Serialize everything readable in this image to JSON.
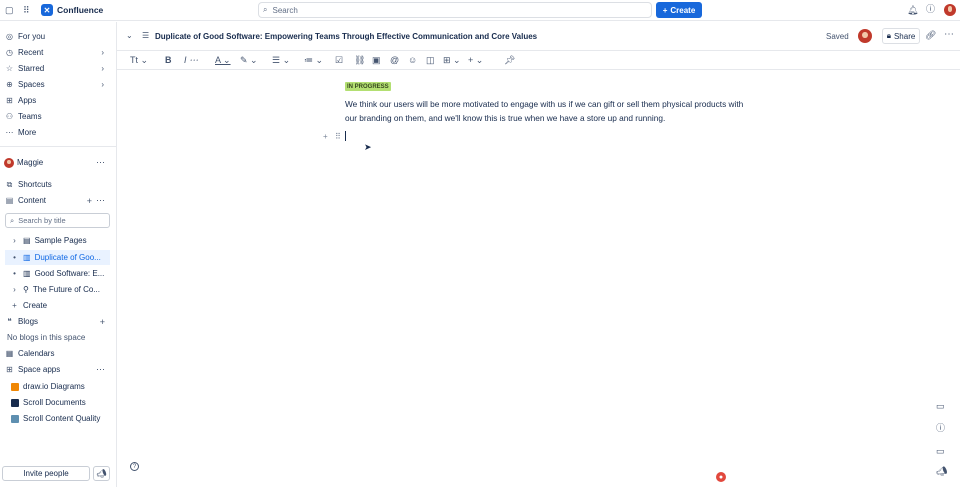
{
  "app": {
    "name": "Confluence"
  },
  "topbar": {
    "search_placeholder": "Search",
    "create_label": "Create",
    "create_plus": "+"
  },
  "sidebar": {
    "nav": [
      {
        "icon": "user-circle-icon",
        "glyph": "◎",
        "label": "For you"
      },
      {
        "icon": "clock-icon",
        "glyph": "◷",
        "label": "Recent",
        "chevron": "›"
      },
      {
        "icon": "star-icon",
        "glyph": "☆",
        "label": "Starred",
        "chevron": "›"
      },
      {
        "icon": "globe-icon",
        "glyph": "⊕",
        "label": "Spaces",
        "chevron": "›"
      },
      {
        "icon": "apps-icon",
        "glyph": "⊞",
        "label": "Apps"
      },
      {
        "icon": "teams-icon",
        "glyph": "⚇",
        "label": "Teams"
      },
      {
        "icon": "more-icon",
        "glyph": "⋯",
        "label": "More"
      }
    ],
    "space_name": "Maggie",
    "shortcuts": "Shortcuts",
    "content": "Content",
    "filter_placeholder": "Search by title",
    "tree": [
      {
        "label": "Sample Pages",
        "selected": false
      },
      {
        "label": "Duplicate of Goo...",
        "selected": true
      },
      {
        "label": "Good Software: E...",
        "selected": false
      },
      {
        "label": "The Future of Co...",
        "selected": false
      }
    ],
    "create_label": "Create",
    "blogs": "Blogs",
    "no_blogs": "No blogs in this space",
    "calendars": "Calendars",
    "space_apps": "Space apps",
    "apps": [
      {
        "label": "draw.io Diagrams",
        "color": "#f08705"
      },
      {
        "label": "Scroll Documents",
        "color": "#172b4d"
      },
      {
        "label": "Scroll Content Quality",
        "color": "#5e8fb0"
      }
    ],
    "invite": "Invite people"
  },
  "page": {
    "title": "Duplicate of Good Software: Empowering Teams Through Effective Communication and Core Values",
    "saved": "Saved",
    "share": "Share",
    "status": "IN PROGRESS",
    "status_color": "#b3df72",
    "paragraph": "We think our users will be more motivated to engage with us if we can gift or sell them physical products with our branding on them, and we'll know this is true when we have a store up and running."
  },
  "toolbar": {
    "text_style": "Tt"
  }
}
